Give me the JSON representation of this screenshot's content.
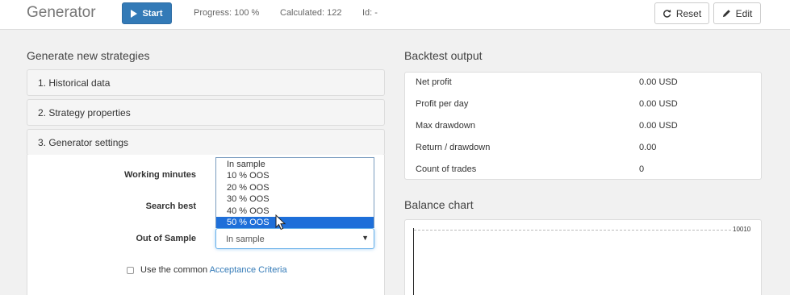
{
  "header": {
    "title": "Generator",
    "start_label": "Start",
    "progress": "Progress: 100 %",
    "calculated": "Calculated: 122",
    "id": "Id: -",
    "reset_label": "Reset",
    "edit_label": "Edit"
  },
  "left": {
    "section_title": "Generate new strategies",
    "accordion": [
      {
        "label": "1. Historical data"
      },
      {
        "label": "2. Strategy properties"
      },
      {
        "label": "3. Generator settings"
      }
    ],
    "form": {
      "working_minutes_label": "Working minutes",
      "search_best_label": "Search best",
      "out_of_sample_label": "Out of Sample",
      "out_of_sample_value": "In sample",
      "dropdown_options": [
        "In sample",
        "10 % OOS",
        "20 % OOS",
        "30 % OOS",
        "40 % OOS",
        "50 % OOS"
      ],
      "highlighted_option": "50 % OOS",
      "acceptance_prefix": "Use the common ",
      "acceptance_link": "Acceptance Criteria"
    }
  },
  "right": {
    "backtest_title": "Backtest output",
    "backtest_rows": [
      {
        "label": "Net profit",
        "value": "0.00 USD"
      },
      {
        "label": "Profit per day",
        "value": "0.00 USD"
      },
      {
        "label": "Max drawdown",
        "value": "0.00 USD"
      },
      {
        "label": "Return / drawdown",
        "value": "0.00"
      },
      {
        "label": "Count of trades",
        "value": "0"
      }
    ],
    "balance_title": "Balance chart",
    "balance_tick": "10010"
  },
  "colors": {
    "primary": "#337ab7",
    "highlight": "#1e6fd9",
    "link": "#337ab7"
  },
  "icons": {
    "start": "play-icon",
    "reset": "refresh-icon",
    "edit": "pencil-icon",
    "select": "caret-down-icon",
    "pointer": "mouse-pointer-icon"
  }
}
